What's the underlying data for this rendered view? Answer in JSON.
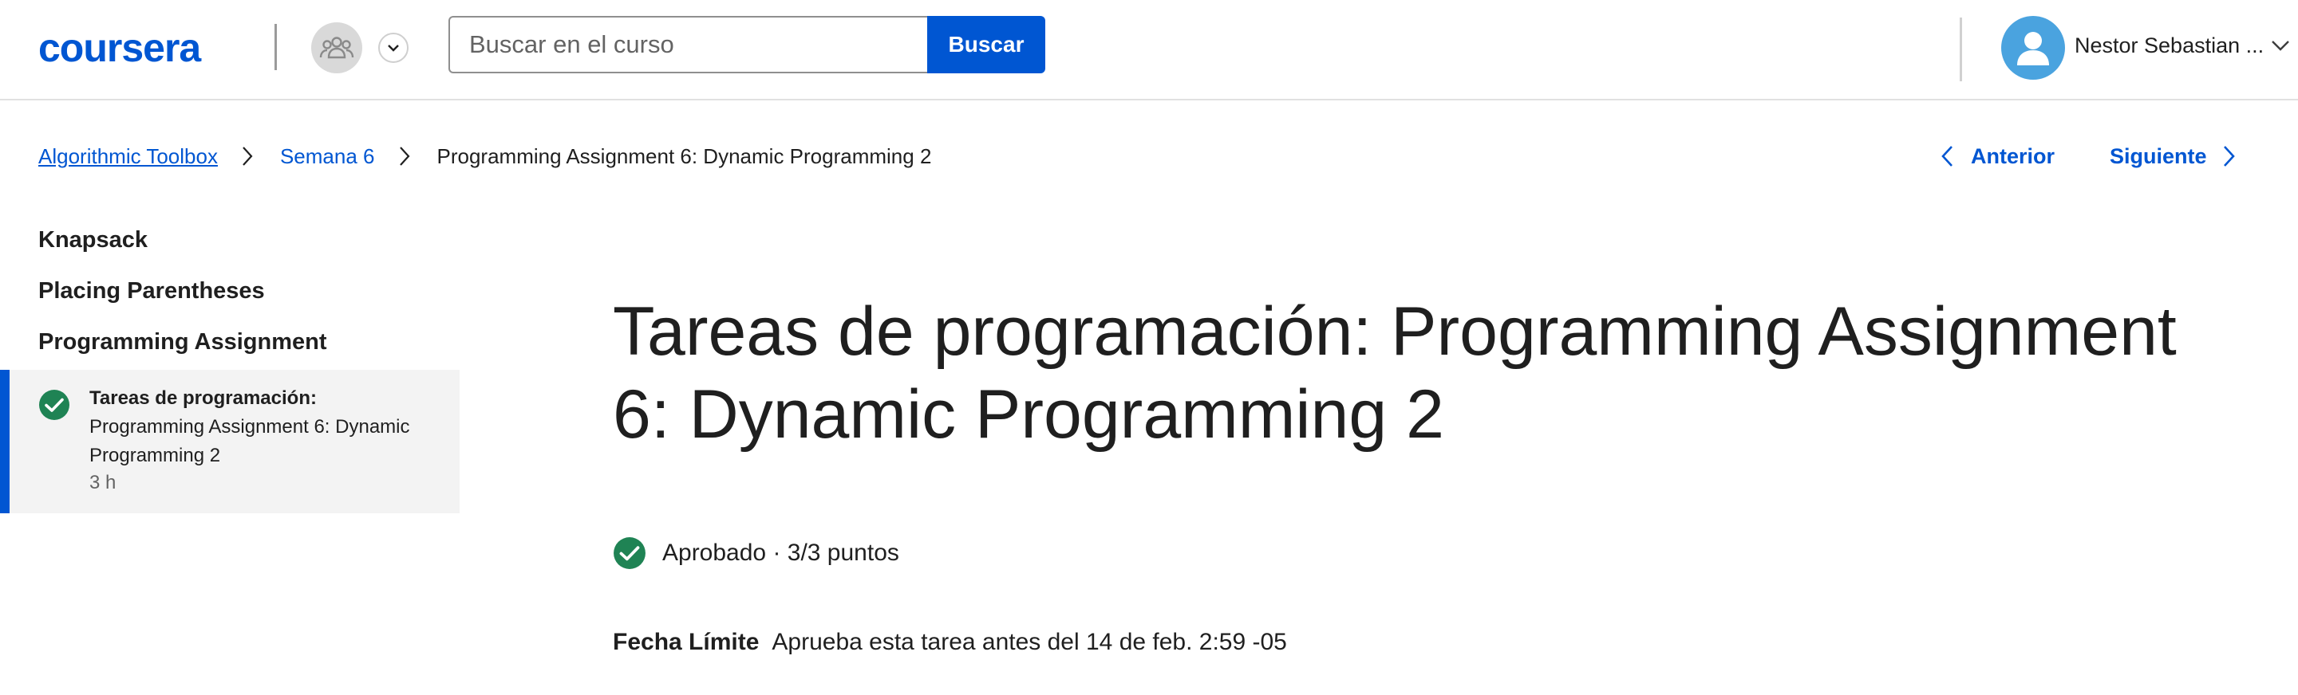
{
  "header": {
    "logo": "coursera",
    "search_placeholder": "Buscar en el curso",
    "search_button": "Buscar",
    "user_name": "Nestor Sebastian ...",
    "icons": {
      "group": "group-people-icon",
      "group_dropdown": "chevron-down-icon",
      "user": "user-avatar-icon",
      "user_dropdown": "chevron-down-icon"
    }
  },
  "breadcrumb": {
    "items": [
      "Algorithmic Toolbox",
      "Semana 6",
      "Programming Assignment 6: Dynamic Programming 2"
    ]
  },
  "nav": {
    "previous": "Anterior",
    "next": "Siguiente"
  },
  "sidebar": {
    "sections": [
      "Knapsack",
      "Placing Parentheses",
      "Programming Assignment"
    ],
    "active_item": {
      "type_label": "Tareas de programación:",
      "title": "Programming Assignment 6: Dynamic Programming 2",
      "duration": "3 h",
      "status_icon": "check-circle-icon"
    }
  },
  "main": {
    "title": "Tareas de programación: Programming Assignment 6: Dynamic Programming 2",
    "grade": "Aprobado · 3/3 puntos",
    "due_label": "Fecha Límite",
    "due_text": "Aprueba esta tarea antes del 14 de feb. 2:59 -05"
  },
  "colors": {
    "brand": "#0056d2",
    "success": "#1f8354",
    "user_avatar": "#4aa3df"
  }
}
